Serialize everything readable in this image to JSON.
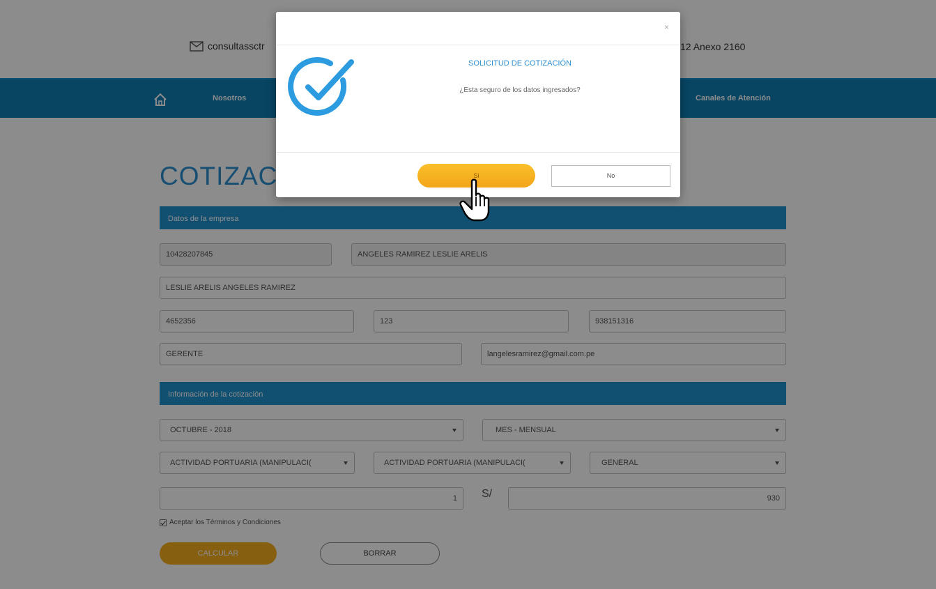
{
  "header": {
    "email": "consultassctr",
    "phone": "12 Anexo 2160"
  },
  "nav": {
    "items": [
      "Nosotros",
      "Canales de Atención"
    ]
  },
  "page_title": "COTIZACIÓN",
  "sections": {
    "empresa": "Datos de la empresa",
    "cotizacion": "Información de la cotización"
  },
  "form": {
    "ruc": "10428207845",
    "razon_social": "ANGELES RAMIREZ LESLIE ARELIS",
    "contacto": "LESLIE ARELIS ANGELES RAMIREZ",
    "telefono": "4652356",
    "anexo": "123",
    "celular": "938151316",
    "cargo": "GERENTE",
    "email": "langelesramirez@gmail.com.pe",
    "periodo": "OCTUBRE - 2018",
    "frecuencia": "MES - MENSUAL",
    "actividad1": "ACTIVIDAD PORTUARIA (MANIPULACI(",
    "actividad2": "ACTIVIDAD PORTUARIA (MANIPULACI(",
    "tipo": "GENERAL",
    "cantidad": "1",
    "moneda": "S/",
    "monto": "930",
    "terminos": "Aceptar los Términos y Condiciones"
  },
  "buttons": {
    "calcular": "CALCULAR",
    "borrar": "BORRAR"
  },
  "modal": {
    "close": "×",
    "title": "SOLICITUD DE COTIZACIÓN",
    "message": "¿Esta seguro de los datos ingresados?",
    "yes": "Si",
    "no": "No"
  },
  "colors": {
    "brand_blue": "#0f7fb5",
    "section_blue": "#2293d0",
    "accent_orange": "#f5ad1e",
    "title_blue": "#2d8ed0"
  },
  "icons": [
    "mail-icon",
    "home-icon",
    "check-circle-icon",
    "hand-pointer-icon"
  ]
}
